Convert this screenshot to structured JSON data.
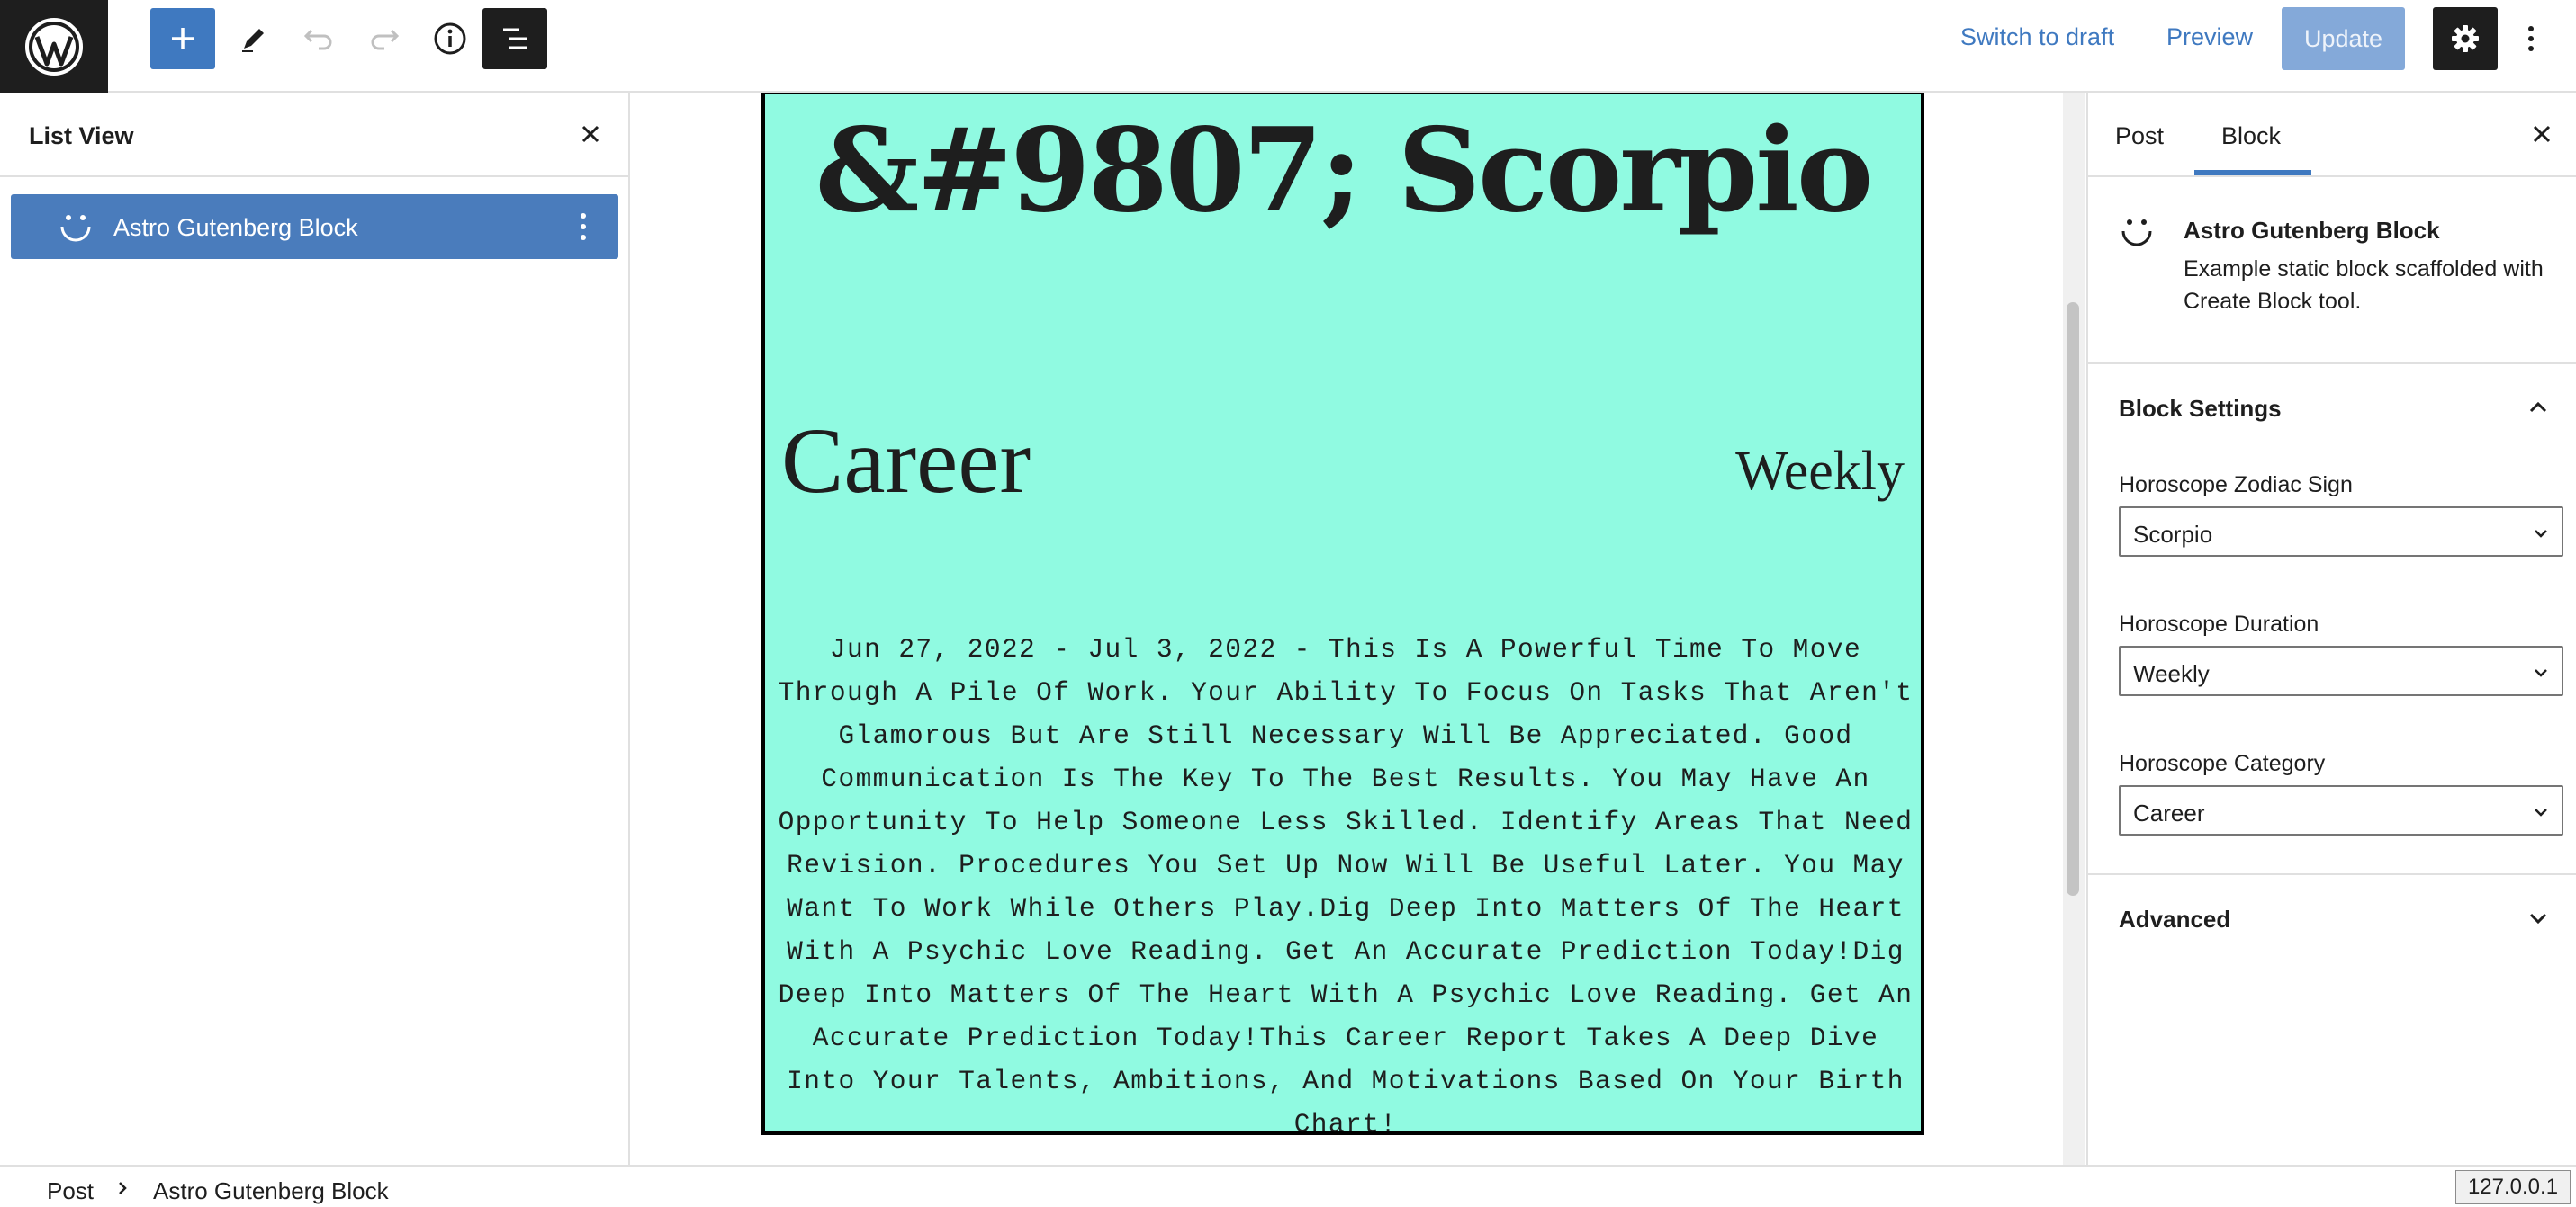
{
  "toolbar": {
    "switch_to_draft": "Switch to draft",
    "preview": "Preview",
    "update": "Update",
    "icons": [
      "wordpress-logo",
      "plus-icon",
      "pencil-icon",
      "undo-icon",
      "redo-icon",
      "info-icon",
      "list-view-icon",
      "gear-icon",
      "more-vertical-icon"
    ]
  },
  "list_view": {
    "title": "List View",
    "items": [
      {
        "label": "Astro Gutenberg Block",
        "icon": "smiley-icon"
      }
    ]
  },
  "canvas": {
    "sign_title": "&#9807; Scorpio",
    "category": "Career",
    "duration": "Weekly",
    "horoscope_text": "Jun 27, 2022 - Jul 3, 2022 - This Is A Powerful Time To Move Through A Pile Of Work. Your Ability To Focus On Tasks That Aren't Glamorous But Are Still Necessary Will Be Appreciated. Good Communication Is The Key To The Best Results. You May Have An Opportunity To Help Someone Less Skilled. Identify Areas That Need Revision. Procedures You Set Up Now Will Be Useful Later. You May Want To Work While Others Play.Dig Deep Into Matters Of The Heart With A Psychic Love Reading. Get An Accurate Prediction Today!Dig Deep Into Matters Of The Heart With A Psychic Love Reading. Get An Accurate Prediction Today!This Career Report Takes A Deep Dive Into Your Talents, Ambitions, And Motivations Based On Your Birth Chart!",
    "block_background": "#90fae1"
  },
  "sidebar": {
    "tabs": [
      {
        "label": "Post"
      },
      {
        "label": "Block",
        "active": true
      }
    ],
    "block_card": {
      "name": "Astro Gutenberg Block",
      "description": "Example static block scaffolded with Create Block tool."
    },
    "block_settings": {
      "title": "Block Settings",
      "fields": [
        {
          "label": "Horoscope Zodiac Sign",
          "value": "Scorpio"
        },
        {
          "label": "Horoscope Duration",
          "value": "Weekly"
        },
        {
          "label": "Horoscope Category",
          "value": "Career"
        }
      ]
    },
    "advanced": {
      "title": "Advanced"
    }
  },
  "footer": {
    "breadcrumb": [
      "Post",
      "Astro Gutenberg Block"
    ],
    "host": "127.0.0.1"
  },
  "colors": {
    "accent": "#3f79c0",
    "update_disabled": "#84a9d9",
    "dark": "#1e1e1e"
  }
}
